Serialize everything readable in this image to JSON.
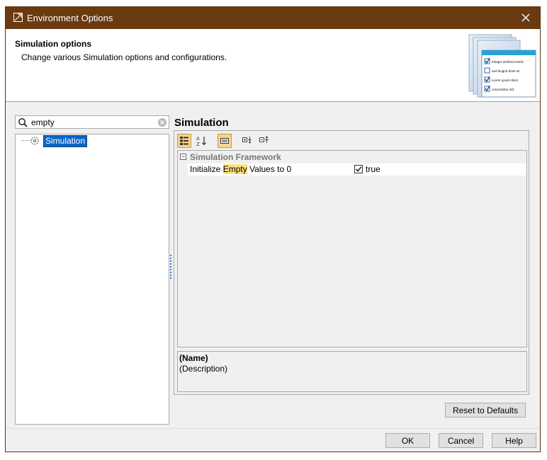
{
  "window": {
    "title": "Environment Options",
    "close_icon": "close-icon"
  },
  "header": {
    "title": "Simulation options",
    "description": "Change various Simulation options and configurations.",
    "art": {
      "items": [
        {
          "label": "Integer eleifend mollis",
          "checked": true
        },
        {
          "label": "sed feugiat diam et.",
          "checked": false
        },
        {
          "label": "Lorem ipsum dolor",
          "checked": true
        },
        {
          "label": "consectetur elit.",
          "checked": true
        }
      ]
    }
  },
  "search": {
    "value": "empty",
    "icon": "search-icon",
    "clear_icon": "clear-icon"
  },
  "tree": {
    "items": [
      {
        "label": "Simulation",
        "selected": true,
        "icon": "gear-icon"
      }
    ]
  },
  "panel": {
    "title": "Simulation",
    "toolbar": [
      {
        "name": "categorized-view",
        "icon": "categorized-icon",
        "active": true
      },
      {
        "name": "sort-alphabetically",
        "icon": "sort-az-icon",
        "active": false
      },
      {
        "name": "show-description",
        "icon": "description-icon",
        "active": true
      },
      {
        "name": "expand-all",
        "icon": "expand-all-icon",
        "active": false
      },
      {
        "name": "collapse-all",
        "icon": "collapse-all-icon",
        "active": false
      }
    ],
    "categories": [
      {
        "label": "Simulation Framework",
        "expanded": true,
        "properties": [
          {
            "name_before": "Initialize ",
            "name_highlight": "Empty",
            "name_after": " Values to 0",
            "checked": true,
            "value": "true"
          }
        ]
      }
    ],
    "description": {
      "name": "(Name)",
      "text": "(Description)"
    },
    "reset_label": "Reset to Defaults"
  },
  "footer": {
    "ok_label": "OK",
    "cancel_label": "Cancel",
    "help_label": "Help"
  },
  "colors": {
    "titlebar": "#6b3a10",
    "selection": "#0a64c8",
    "highlight": "#fddf7e",
    "active_tool": "#f7d58a"
  }
}
